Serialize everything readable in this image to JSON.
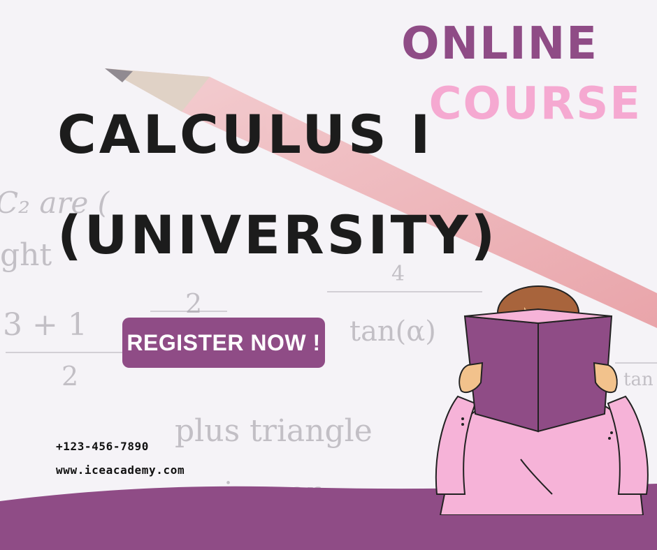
{
  "flyer": {
    "title_line1": "CALCULUS I",
    "title_line2": "(UNIVERSITY)",
    "badge_line1": "ONLINE",
    "badge_line2": "COURSE",
    "cta_label": "REGISTER NOW !",
    "phone": "+123-456-7890",
    "website": "www.iceacademy.com"
  },
  "background_math": [
    "C₂ are (",
    "ght",
    "3 + 1",
    "2",
    "2",
    "tan(α)",
    "plus triangle",
    "rium ar",
    "4",
    "tan"
  ],
  "colors": {
    "purple": "#8f4c86",
    "pink": "#f5a9d1",
    "text_dark": "#1c1c1c",
    "pencil": "#e7888e"
  },
  "illustration": "person-reading-book"
}
